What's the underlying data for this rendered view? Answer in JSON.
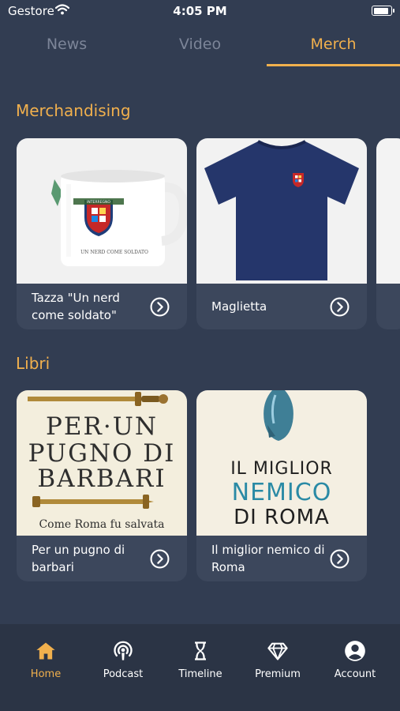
{
  "status_bar": {
    "carrier": "Gestore",
    "time": "4:05 PM",
    "battery_level": 0.9
  },
  "tabs": [
    {
      "label": "News",
      "active": false
    },
    {
      "label": "Video",
      "active": false
    },
    {
      "label": "Merch",
      "active": true
    }
  ],
  "merch_section": {
    "title": "Merchandising",
    "items": [
      {
        "label": "Tazza \"Un nerd come soldato\"",
        "image": "mug-image",
        "mug_caption": "UN NERD COME SOLDATO",
        "badge_text": "INTERREGNO"
      },
      {
        "label": "Maglietta",
        "image": "tshirt-image"
      }
    ]
  },
  "books_section": {
    "title": "Libri",
    "items": [
      {
        "label": "Per un pugno di barbari",
        "cover_lines": [
          "PER·UN",
          "PUGNO DI",
          "BARBARI"
        ],
        "cover_subtitle": "Come Roma fu salvata"
      },
      {
        "label": "Il miglior nemico di Roma",
        "cover_lines": [
          "IL MIGLIOR",
          "NEMICO",
          "DI ROMA"
        ]
      }
    ]
  },
  "bottom_nav": [
    {
      "label": "Home",
      "icon": "home-icon",
      "active": true
    },
    {
      "label": "Podcast",
      "icon": "podcast-icon",
      "active": false
    },
    {
      "label": "Timeline",
      "icon": "hourglass-icon",
      "active": false
    },
    {
      "label": "Premium",
      "icon": "diamond-icon",
      "active": false
    },
    {
      "label": "Account",
      "icon": "account-icon",
      "active": false
    }
  ],
  "colors": {
    "background": "#323d52",
    "accent": "#f1b04d",
    "card": "#3c475c",
    "nav": "#2b3445",
    "inactive_tab": "#7c8598"
  }
}
